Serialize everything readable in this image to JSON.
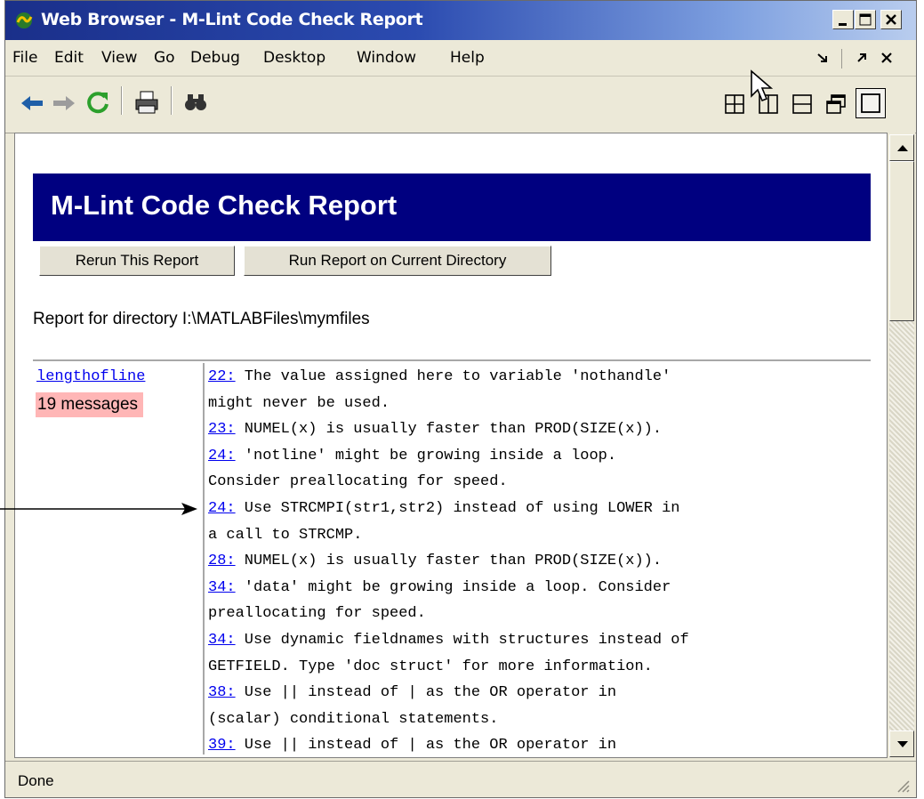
{
  "window": {
    "title": "Web Browser - M-Lint Code Check Report"
  },
  "menu": [
    "File",
    "Edit",
    "View",
    "Go",
    "Debug",
    "Desktop",
    "Window",
    "Help"
  ],
  "report": {
    "heading": "M-Lint Code Check Report",
    "rerun_label": "Rerun This Report",
    "run_current_label": "Run Report on Current Directory",
    "directory_line": "Report for directory I:\\MATLABFiles\\mymfiles",
    "file": {
      "name": "lengthofline",
      "message_count": "19 messages"
    },
    "lines": [
      {
        "num": "22:",
        "text": " The value assigned here to variable 'nothandle'"
      },
      {
        "num": "",
        "text": "might never be used."
      },
      {
        "num": "23:",
        "text": " NUMEL(x) is usually faster than PROD(SIZE(x))."
      },
      {
        "num": "24:",
        "text": " 'notline' might be growing inside a loop."
      },
      {
        "num": "",
        "text": "Consider preallocating for speed."
      },
      {
        "num": "24:",
        "text": " Use STRCMPI(str1,str2) instead of using LOWER in"
      },
      {
        "num": "",
        "text": "a call to STRCMP."
      },
      {
        "num": "28:",
        "text": " NUMEL(x) is usually faster than PROD(SIZE(x))."
      },
      {
        "num": "34:",
        "text": " 'data' might be growing inside a loop. Consider"
      },
      {
        "num": "",
        "text": "preallocating for speed."
      },
      {
        "num": "34:",
        "text": " Use dynamic fieldnames with structures instead of"
      },
      {
        "num": "",
        "text": "GETFIELD. Type 'doc struct' for more information."
      },
      {
        "num": "38:",
        "text": " Use || instead of | as the OR operator in"
      },
      {
        "num": "",
        "text": "(scalar) conditional statements."
      },
      {
        "num": "39:",
        "text": " Use || instead of | as the OR operator in"
      }
    ]
  },
  "status": {
    "text": "Done"
  },
  "colors": {
    "banner": "#000080",
    "badge": "#ffb6b6",
    "link": "#0000ee"
  }
}
